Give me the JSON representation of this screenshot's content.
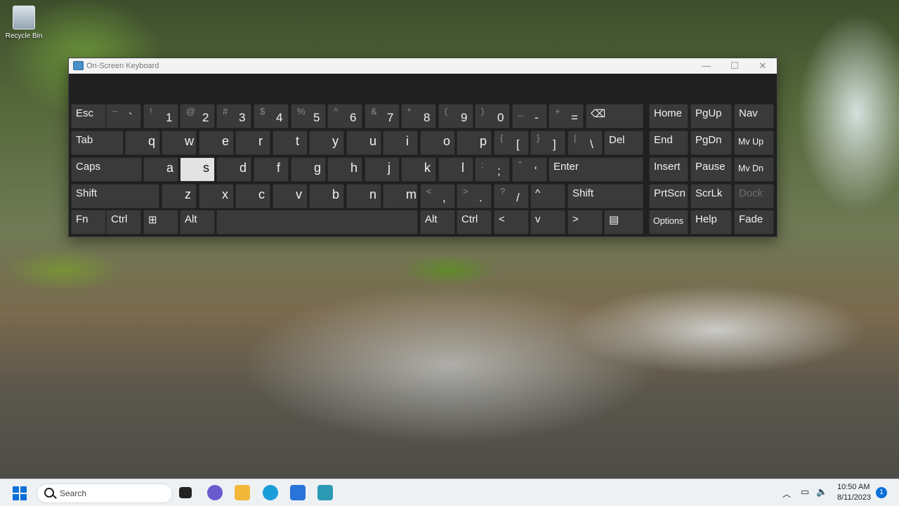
{
  "desktop": {
    "recycle_bin_label": "Recycle Bin"
  },
  "osk": {
    "title": "On-Screen Keyboard",
    "window_controls": {
      "minimize": "—",
      "maximize": "☐",
      "close": "✕"
    },
    "row1": [
      {
        "label": "Esc"
      },
      {
        "shift": "~",
        "main": "`"
      },
      {
        "shift": "!",
        "main": "1"
      },
      {
        "shift": "@",
        "main": "2"
      },
      {
        "shift": "#",
        "main": "3"
      },
      {
        "shift": "$",
        "main": "4"
      },
      {
        "shift": "%",
        "main": "5"
      },
      {
        "shift": "^",
        "main": "6"
      },
      {
        "shift": "&",
        "main": "7"
      },
      {
        "shift": "*",
        "main": "8"
      },
      {
        "shift": "(",
        "main": "9"
      },
      {
        "shift": ")",
        "main": "0"
      },
      {
        "shift": "_",
        "main": "-"
      },
      {
        "shift": "+",
        "main": "="
      },
      {
        "label": "⌫"
      }
    ],
    "row2": [
      {
        "label": "Tab"
      },
      {
        "letter": "q"
      },
      {
        "letter": "w"
      },
      {
        "letter": "e"
      },
      {
        "letter": "r"
      },
      {
        "letter": "t"
      },
      {
        "letter": "y"
      },
      {
        "letter": "u"
      },
      {
        "letter": "i"
      },
      {
        "letter": "o"
      },
      {
        "letter": "p"
      },
      {
        "shift": "{",
        "main": "["
      },
      {
        "shift": "}",
        "main": "]"
      },
      {
        "shift": "|",
        "main": "\\"
      },
      {
        "label": "Del"
      }
    ],
    "row3": [
      {
        "label": "Caps"
      },
      {
        "letter": "a"
      },
      {
        "letter": "s"
      },
      {
        "letter": "d"
      },
      {
        "letter": "f"
      },
      {
        "letter": "g"
      },
      {
        "letter": "h"
      },
      {
        "letter": "j"
      },
      {
        "letter": "k"
      },
      {
        "letter": "l"
      },
      {
        "shift": ":",
        "main": ";"
      },
      {
        "shift": "\"",
        "main": "'"
      },
      {
        "label": "Enter"
      }
    ],
    "row4": [
      {
        "label": "Shift"
      },
      {
        "letter": "z"
      },
      {
        "letter": "x"
      },
      {
        "letter": "c"
      },
      {
        "letter": "v"
      },
      {
        "letter": "b"
      },
      {
        "letter": "n"
      },
      {
        "letter": "m"
      },
      {
        "shift": "<",
        "main": ","
      },
      {
        "shift": ">",
        "main": "."
      },
      {
        "shift": "?",
        "main": "/"
      },
      {
        "label": "^"
      },
      {
        "label": "Shift"
      }
    ],
    "row5": [
      {
        "label": "Fn"
      },
      {
        "label": "Ctrl"
      },
      {
        "label": "⊞"
      },
      {
        "label": "Alt"
      },
      {
        "label": ""
      },
      {
        "label": "Alt"
      },
      {
        "label": "Ctrl"
      },
      {
        "label": "<"
      },
      {
        "label": "v"
      },
      {
        "label": ">"
      },
      {
        "label": "▤"
      }
    ],
    "nav": [
      [
        "Home",
        "PgUp",
        "Nav"
      ],
      [
        "End",
        "PgDn",
        "Mv Up"
      ],
      [
        "Insert",
        "Pause",
        "Mv Dn"
      ],
      [
        "PrtScn",
        "ScrLk",
        "Dock"
      ],
      [
        "Options",
        "Help",
        "Fade"
      ]
    ],
    "pressed_key": "s"
  },
  "taskbar": {
    "search_placeholder": "Search",
    "time": "10:50 AM",
    "date": "8/11/2023",
    "notification_count": "1"
  }
}
